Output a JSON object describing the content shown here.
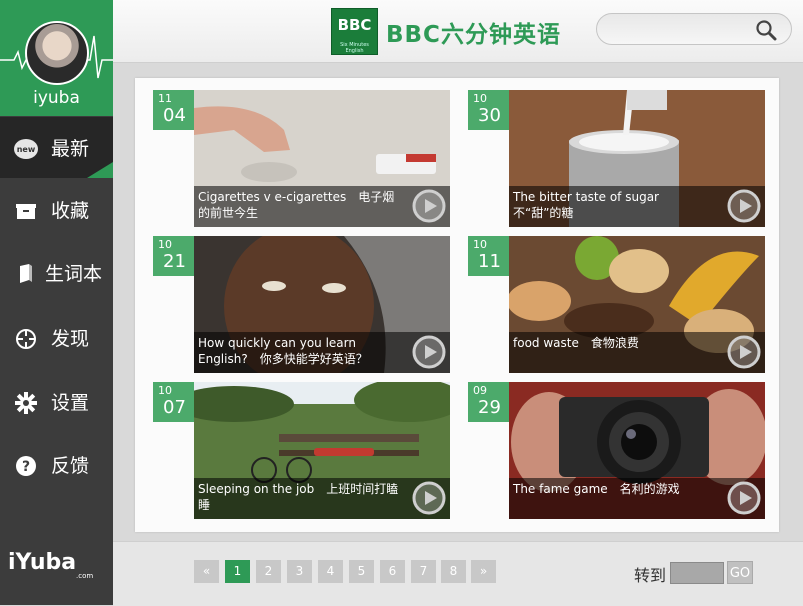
{
  "app": {
    "title": "BBC六分钟英语",
    "logo_text": "BBC",
    "logo_sub": "Six Minutes English"
  },
  "user": {
    "name": "iyuba"
  },
  "nav": [
    {
      "label": "最新",
      "icon": "new-icon",
      "badge": "new",
      "active": true
    },
    {
      "label": "收藏",
      "icon": "box-icon"
    },
    {
      "label": "生词本",
      "icon": "book-icon"
    },
    {
      "label": "发现",
      "icon": "compass-icon"
    },
    {
      "label": "设置",
      "icon": "gear-icon"
    },
    {
      "label": "反馈",
      "icon": "help-icon"
    }
  ],
  "brand": {
    "name": "iYuba",
    "sub": ".com"
  },
  "search": {
    "value": "",
    "placeholder": ""
  },
  "articles": [
    {
      "month": "11",
      "day": "04",
      "title": "Cigarettes v e-cigarettes　电子烟的前世今生"
    },
    {
      "month": "10",
      "day": "30",
      "title": "The bitter taste of sugar　不“甜”的糖"
    },
    {
      "month": "10",
      "day": "21",
      "title": "How quickly can you learn English?　你多快能学好英语？"
    },
    {
      "month": "10",
      "day": "11",
      "title": "food waste　食物浪费"
    },
    {
      "month": "10",
      "day": "07",
      "title": "Sleeping on the job　上班时间打瞌睡"
    },
    {
      "month": "09",
      "day": "29",
      "title": "The fame game　名利的游戏"
    }
  ],
  "pagination": {
    "prev": "«",
    "next": "»",
    "pages": [
      "1",
      "2",
      "3",
      "4",
      "5",
      "6",
      "7",
      "8"
    ],
    "current": "1",
    "goto_label": "转到",
    "goto_value": "",
    "go_label": "GO"
  },
  "colors": {
    "accent": "#2e9a56",
    "sidebar": "#3c3c3c",
    "date_badge": "#4caa6b"
  }
}
